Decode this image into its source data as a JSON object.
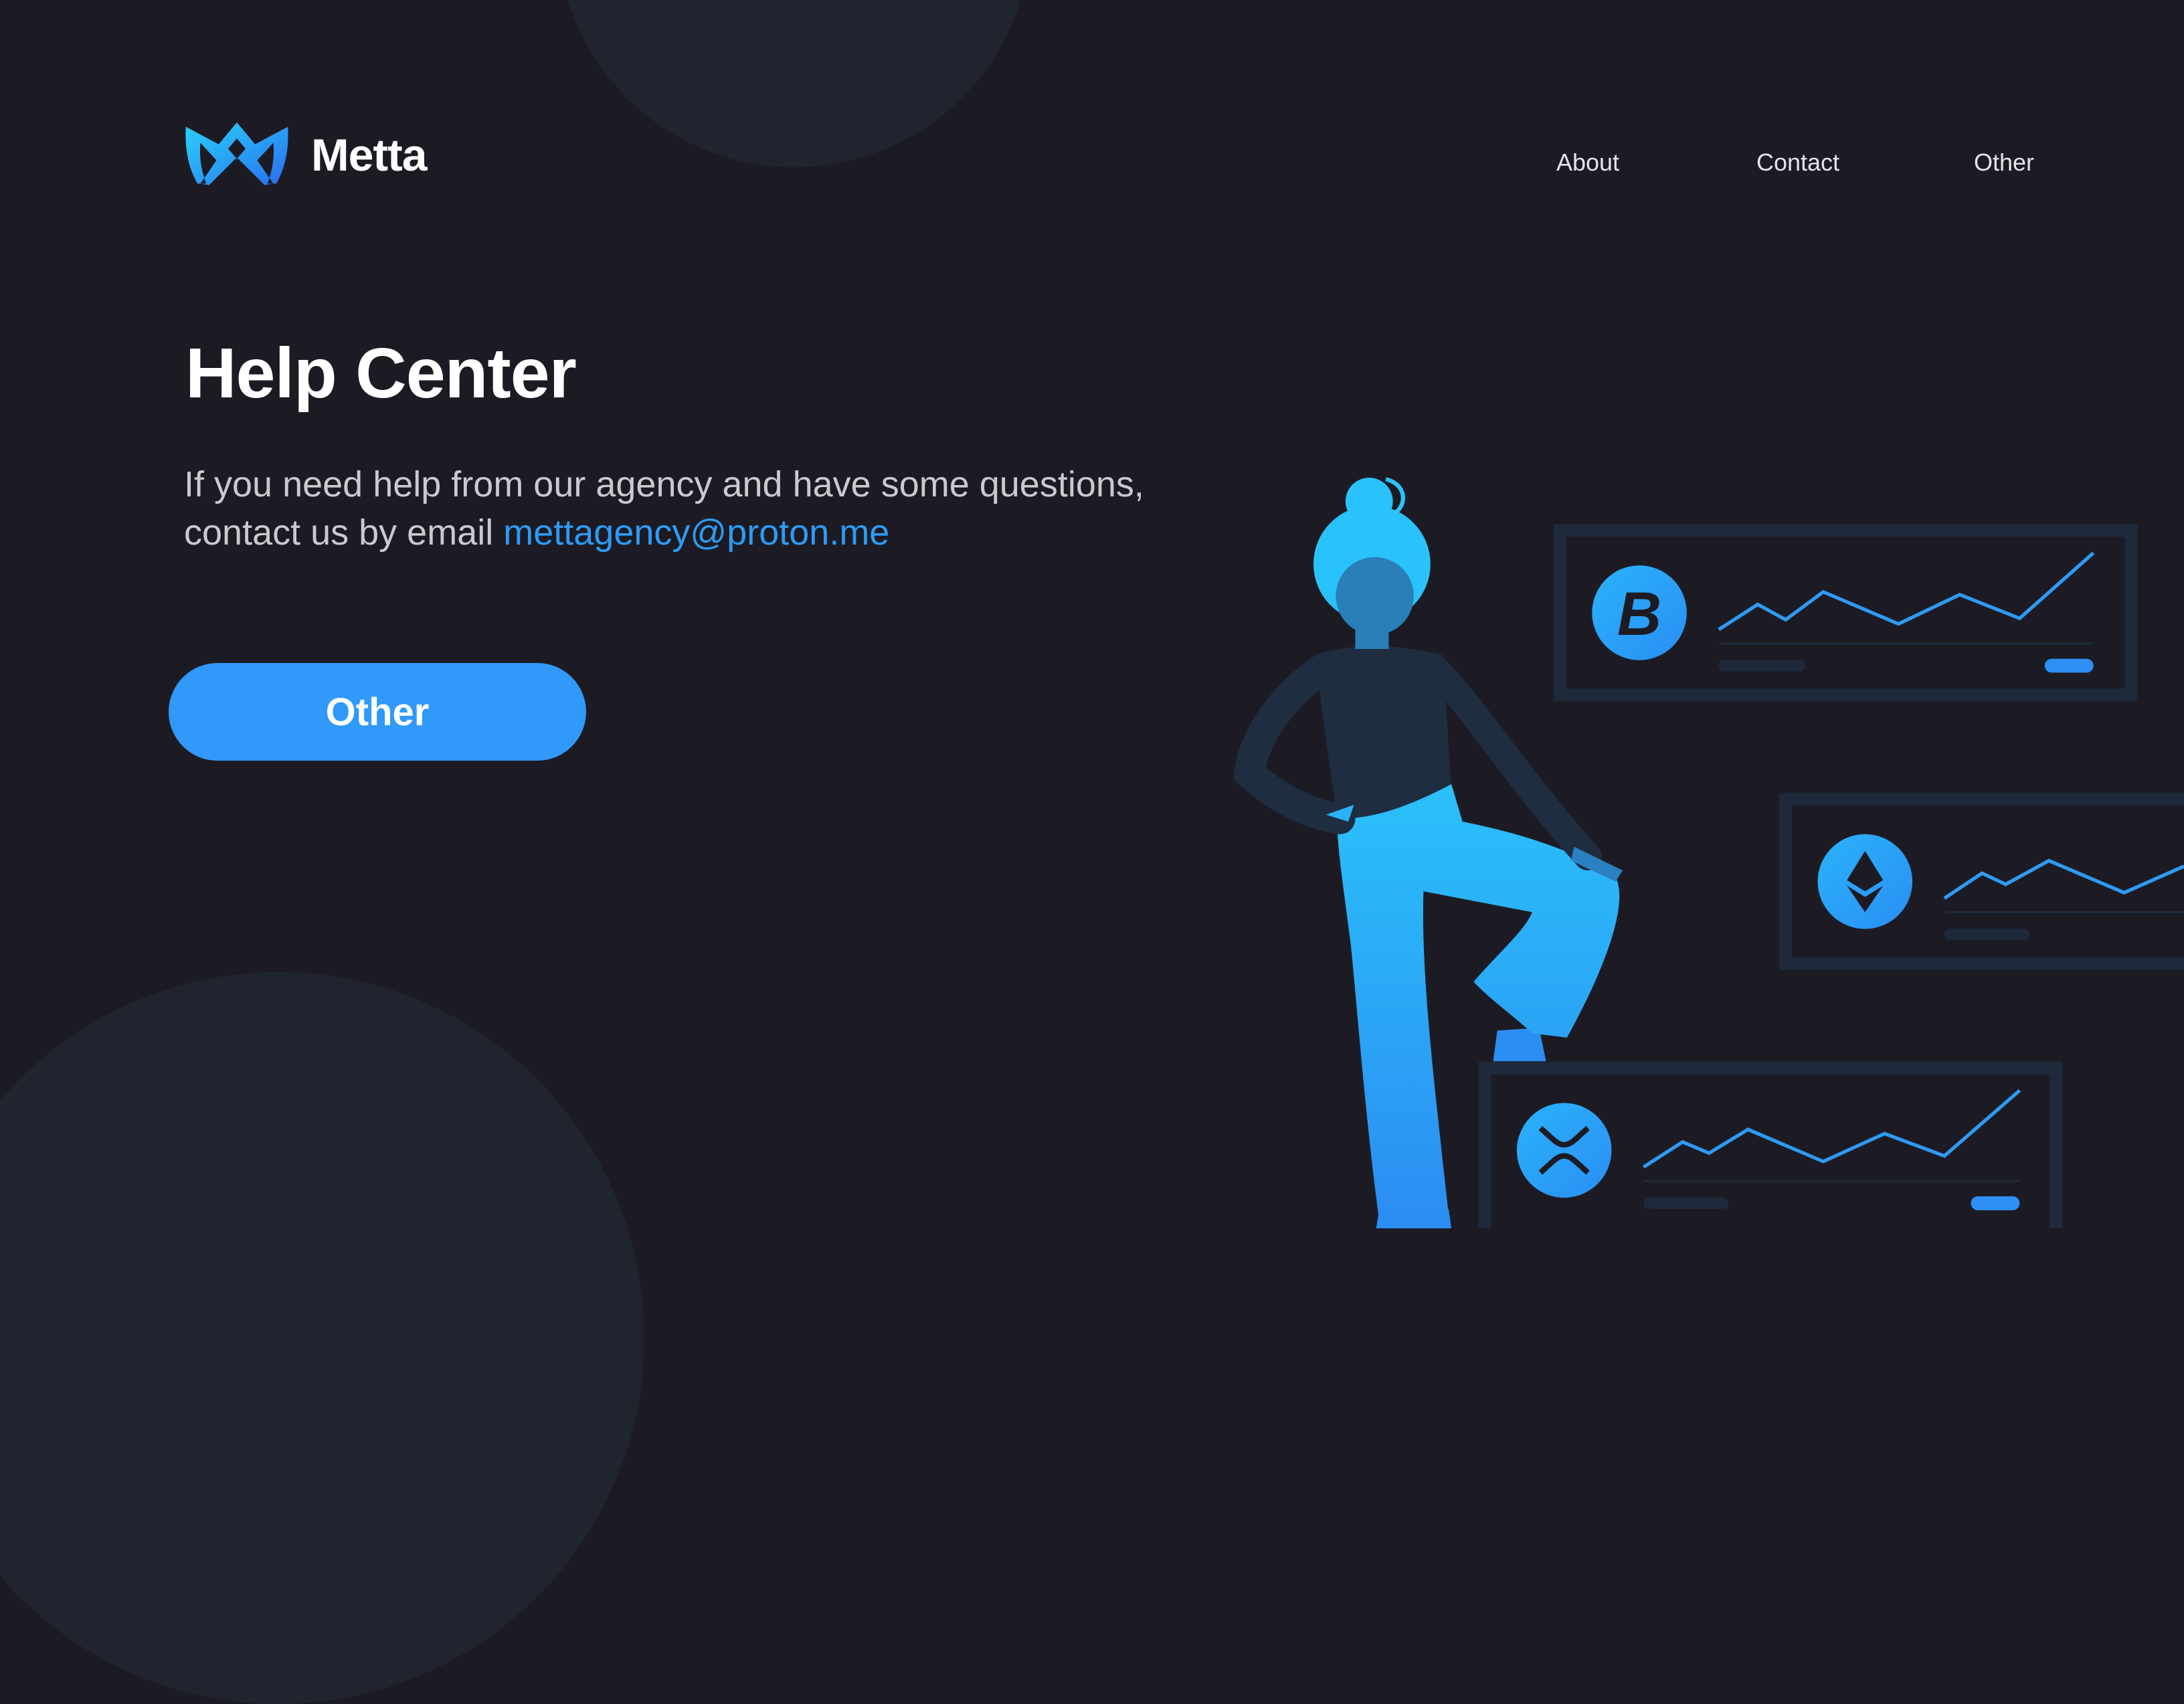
{
  "brand": {
    "name": "Metta",
    "logo_icon": "crown-m-logo"
  },
  "nav": {
    "items": [
      {
        "label": "About"
      },
      {
        "label": "Contact"
      },
      {
        "label": "Other"
      }
    ]
  },
  "hero": {
    "title": "Help Center",
    "description": "If you need help from our agency and have some questions, contact us by email",
    "email": "mettagency@proton.me",
    "button_label": "Other"
  },
  "illustration": {
    "cards": [
      {
        "coin": "bitcoin-icon"
      },
      {
        "coin": "ethereum-icon"
      },
      {
        "coin": "xrp-icon"
      }
    ]
  },
  "colors": {
    "background": "#1c1b24",
    "accent": "#3099f9",
    "link": "#2e9bf5",
    "card_border": "#1e2a3b"
  }
}
